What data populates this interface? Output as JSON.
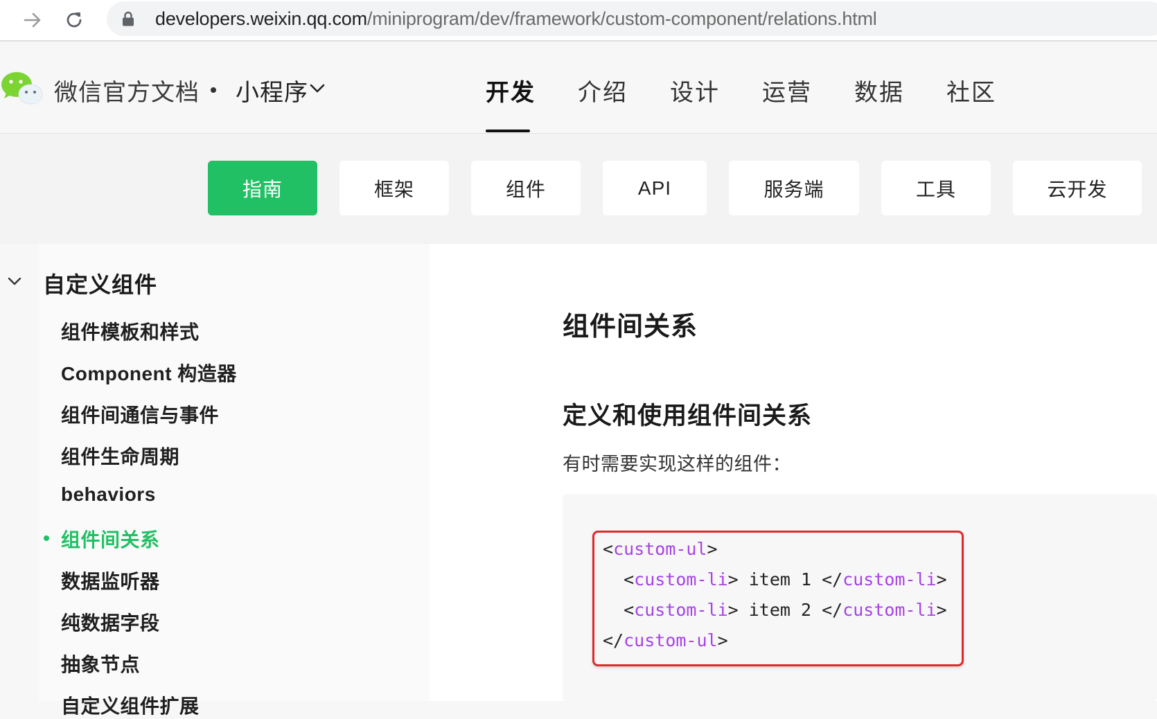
{
  "browser": {
    "url_host": "developers.weixin.qq.com",
    "url_path": "/miniprogram/dev/framework/custom-component/relations.html"
  },
  "header": {
    "brand": "微信官方文档",
    "product": "小程序",
    "nav": [
      "开发",
      "介绍",
      "设计",
      "运营",
      "数据",
      "社区"
    ],
    "active_nav": "开发"
  },
  "sub_nav": {
    "tabs": [
      "指南",
      "框架",
      "组件",
      "API",
      "服务端",
      "工具",
      "云开发"
    ],
    "active": "指南"
  },
  "sidebar": {
    "section": "自定义组件",
    "items": [
      "组件模板和样式",
      "Component 构造器",
      "组件间通信与事件",
      "组件生命周期",
      "behaviors",
      "组件间关系",
      "数据监听器",
      "纯数据字段",
      "抽象节点",
      "自定义组件扩展"
    ],
    "active_item": "组件间关系"
  },
  "content": {
    "title": "组件间关系",
    "heading": "定义和使用组件间关系",
    "paragraph": "有时需要实现这样的组件：",
    "code": {
      "line1_open": "<",
      "line1_tag": "custom-ul",
      "line1_close": ">",
      "line2_indent": "  <",
      "line2_tag1": "custom-li",
      "line2_mid": "> item 1 </",
      "line2_tag2": "custom-li",
      "line2_end": ">",
      "line3_indent": "  <",
      "line3_tag1": "custom-li",
      "line3_mid": "> item 2 </",
      "line3_tag2": "custom-li",
      "line3_end": ">",
      "line4_open": "</",
      "line4_tag": "custom-ul",
      "line4_close": ">"
    }
  },
  "colors": {
    "accent_green": "#21c064",
    "code_tag": "#a742e6",
    "highlight_red": "#e0292b"
  },
  "icons": [
    "arrow-forward-icon",
    "reload-icon",
    "lock-icon",
    "wechat-logo-icon",
    "chevron-down-icon"
  ]
}
